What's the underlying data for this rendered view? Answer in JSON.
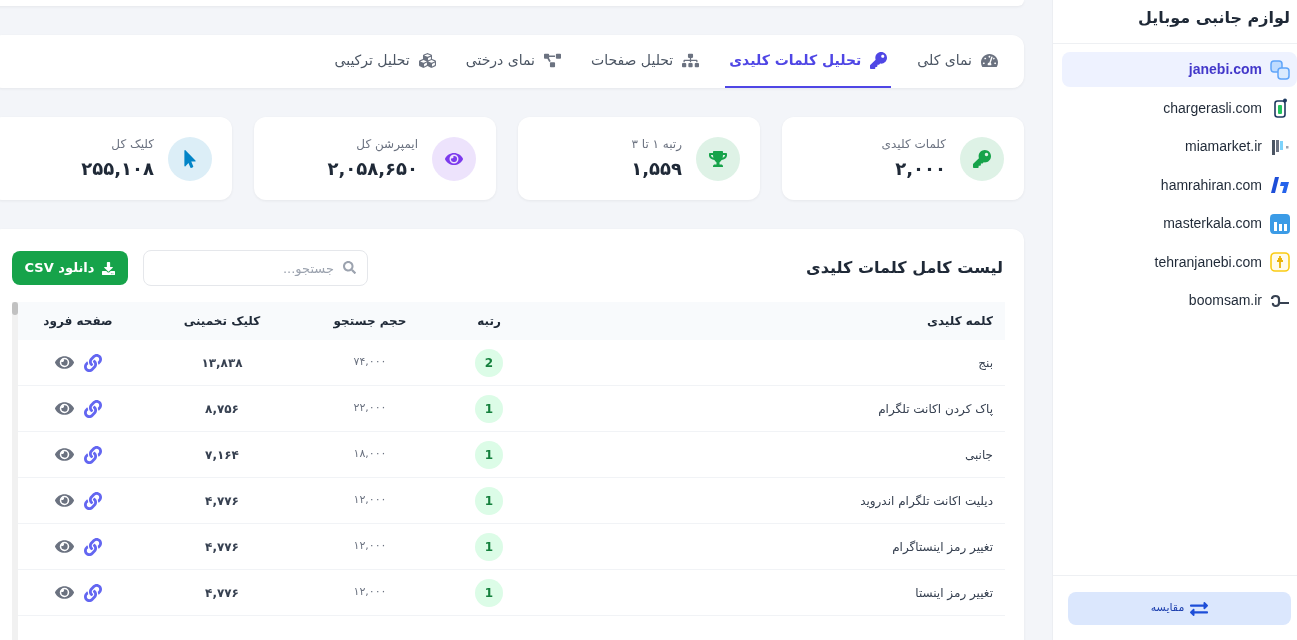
{
  "tabs": [
    {
      "label": "نمای کلی",
      "selected": false
    },
    {
      "label": "تحلیل کلمات کلیدی",
      "selected": true
    },
    {
      "label": "تحلیل صفحات",
      "selected": false
    },
    {
      "label": "نمای درختی",
      "selected": false
    },
    {
      "label": "تحلیل ترکیبی",
      "selected": false
    }
  ],
  "stats": [
    {
      "label": "کلمات کلیدی",
      "value": "۲,۰۰۰",
      "color": "#16a34a"
    },
    {
      "label": "رتبه ۱ تا ۳",
      "value": "۱,۵۵۹",
      "color": "#16a34a"
    },
    {
      "label": "ایمپرشن کل",
      "value": "۲,۰۵۸,۶۵۰",
      "color": "#7c3aed"
    },
    {
      "label": "کلیک کل",
      "value": "۲۵۵,۱۰۸",
      "color": "#0284c7"
    }
  ],
  "keywords_table": {
    "title": "لیست کامل کلمات کلیدی",
    "search": {
      "placeholder": "جستجو..."
    },
    "download_button": "دانلود CSV",
    "columns": [
      "کلمه کلیدی",
      "رتبه",
      "حجم جستجو",
      "کلیک تخمینی",
      "صفحه فرود"
    ],
    "rows": [
      {
        "keyword": "بنج",
        "rank": "2",
        "volume": "۷۴,۰۰۰",
        "clicks": "۱۳,۸۳۸"
      },
      {
        "keyword": "پاک کردن اکانت تلگرام",
        "rank": "1",
        "volume": "۲۲,۰۰۰",
        "clicks": "۸,۷۵۶"
      },
      {
        "keyword": "جانبی",
        "rank": "1",
        "volume": "۱۸,۰۰۰",
        "clicks": "۷,۱۶۴"
      },
      {
        "keyword": "دیلیت اکانت تلگرام اندروید",
        "rank": "1",
        "volume": "۱۲,۰۰۰",
        "clicks": "۴,۷۷۶"
      },
      {
        "keyword": "تغییر رمز اینستاگرام",
        "rank": "1",
        "volume": "۱۲,۰۰۰",
        "clicks": "۴,۷۷۶"
      },
      {
        "keyword": "تغییر رمز اینستا",
        "rank": "1",
        "volume": "۱۲,۰۰۰",
        "clicks": "۴,۷۷۶"
      }
    ]
  },
  "sidebar": {
    "title": "لوازم جانبی موبایل",
    "items": [
      {
        "label": "janebi.com",
        "selected": true
      },
      {
        "label": "chargerasli.com",
        "selected": false
      },
      {
        "label": "miamarket.ir",
        "selected": false
      },
      {
        "label": "hamrahiran.com",
        "selected": false
      },
      {
        "label": "masterkala.com",
        "selected": false
      },
      {
        "label": "tehranjanebi.com",
        "selected": false
      },
      {
        "label": "boomsam.ir",
        "selected": false
      }
    ],
    "compare_button": "مقایسه"
  }
}
